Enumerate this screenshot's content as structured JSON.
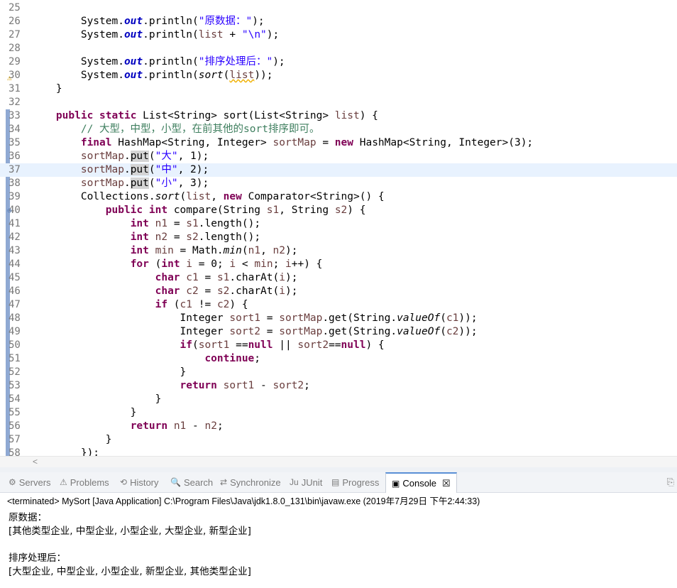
{
  "editor": {
    "lines": [
      {
        "n": "25",
        "html": ""
      },
      {
        "n": "26",
        "html": "        System.<span class='fld'>out</span>.println(<span class='str'>\"原数据：\"</span>);"
      },
      {
        "n": "27",
        "html": "        System.<span class='fld'>out</span>.println(<span class='var'>list</span> + <span class='str'>\"\\n\"</span>);"
      },
      {
        "n": "28",
        "html": ""
      },
      {
        "n": "29",
        "html": "        System.<span class='fld'>out</span>.println(<span class='str'>\"排序处理后：\"</span>);"
      },
      {
        "n": "30",
        "html": "        System.<span class='fld'>out</span>.println(<span class='it'>sort</span>(<span class='var squig'>list</span>));"
      },
      {
        "n": "31",
        "html": "    }"
      },
      {
        "n": "32",
        "html": ""
      },
      {
        "n": "33",
        "html": "    <span class='kw'>public</span> <span class='kw'>static</span> List&lt;String&gt; sort(List&lt;String&gt; <span class='var'>list</span>) {"
      },
      {
        "n": "34",
        "html": "        <span class='cmt'>// 大型，中型，小型，在前其他的sort排序即可。</span>"
      },
      {
        "n": "35",
        "html": "        <span class='kw'>final</span> HashMap&lt;String, Integer&gt; <span class='var'>sortMap</span> = <span class='kw'>new</span> HashMap&lt;String, Integer&gt;(3);"
      },
      {
        "n": "36",
        "html": "        <span class='var'>sortMap</span>.<span class='hl'>put</span>(<span class='str'>\"大\"</span>, 1);"
      },
      {
        "n": "37",
        "html": "        <span class='var'>sortMap</span>.<span class='hl'>put</span>(<span class='str'>\"中\"</span>, 2);"
      },
      {
        "n": "38",
        "html": "        <span class='var'>sortMap</span>.<span class='hl'>put</span>(<span class='str'>\"小\"</span>, 3);"
      },
      {
        "n": "39",
        "html": "        Collections.<span class='it'>sort</span>(<span class='var'>list</span>, <span class='kw'>new</span> Comparator&lt;String&gt;() {"
      },
      {
        "n": "40",
        "html": "            <span class='kw'>public</span> <span class='kw'>int</span> compare(String <span class='var'>s1</span>, String <span class='var'>s2</span>) {"
      },
      {
        "n": "41",
        "html": "                <span class='kw'>int</span> <span class='var'>n1</span> = <span class='var'>s1</span>.length();"
      },
      {
        "n": "42",
        "html": "                <span class='kw'>int</span> <span class='var'>n2</span> = <span class='var'>s2</span>.length();"
      },
      {
        "n": "43",
        "html": "                <span class='kw'>int</span> <span class='var'>min</span> = Math.<span class='it'>min</span>(<span class='var'>n1</span>, <span class='var'>n2</span>);"
      },
      {
        "n": "44",
        "html": "                <span class='kw'>for</span> (<span class='kw'>int</span> <span class='var'>i</span> = 0; <span class='var'>i</span> &lt; <span class='var'>min</span>; <span class='var'>i</span>++) {"
      },
      {
        "n": "45",
        "html": "                    <span class='kw'>char</span> <span class='var'>c1</span> = <span class='var'>s1</span>.charAt(<span class='var'>i</span>);"
      },
      {
        "n": "46",
        "html": "                    <span class='kw'>char</span> <span class='var'>c2</span> = <span class='var'>s2</span>.charAt(<span class='var'>i</span>);"
      },
      {
        "n": "47",
        "html": "                    <span class='kw'>if</span> (<span class='var'>c1</span> != <span class='var'>c2</span>) {"
      },
      {
        "n": "48",
        "html": "                        Integer <span class='var'>sort1</span> = <span class='var'>sortMap</span>.get(String.<span class='it'>valueOf</span>(<span class='var'>c1</span>));"
      },
      {
        "n": "49",
        "html": "                        Integer <span class='var'>sort2</span> = <span class='var'>sortMap</span>.get(String.<span class='it'>valueOf</span>(<span class='var'>c2</span>));"
      },
      {
        "n": "50",
        "html": "                        <span class='kw'>if</span>(<span class='var'>sort1</span> ==<span class='kw'>null</span> || <span class='var'>sort2</span>==<span class='kw'>null</span>) {"
      },
      {
        "n": "51",
        "html": "                            <span class='kw'>continue</span>;"
      },
      {
        "n": "52",
        "html": "                        }"
      },
      {
        "n": "53",
        "html": "                        <span class='kw'>return</span> <span class='var'>sort1</span> - <span class='var'>sort2</span>;"
      },
      {
        "n": "54",
        "html": "                    }"
      },
      {
        "n": "55",
        "html": "                }"
      },
      {
        "n": "56",
        "html": "                <span class='kw'>return</span> <span class='var'>n1</span> - <span class='var'>n2</span>;"
      },
      {
        "n": "57",
        "html": "            }"
      },
      {
        "n": "58",
        "html": "        });"
      }
    ],
    "current_line": "37",
    "warning_line": "30",
    "fold_line": "40"
  },
  "tabs": [
    {
      "id": "servers",
      "label": "Servers",
      "icon": "⚙"
    },
    {
      "id": "problems",
      "label": "Problems",
      "icon": "⚠"
    },
    {
      "id": "history",
      "label": "History",
      "icon": "⟲"
    },
    {
      "id": "search",
      "label": "Search",
      "icon": "🔍"
    },
    {
      "id": "synchronize",
      "label": "Synchronize",
      "icon": "⇄"
    },
    {
      "id": "junit",
      "label": "JUnit",
      "icon": "Ju"
    },
    {
      "id": "progress",
      "label": "Progress",
      "icon": "▤"
    },
    {
      "id": "console",
      "label": "Console",
      "icon": "▣",
      "close": "☒"
    }
  ],
  "console": {
    "status": "<terminated> MySort [Java Application] C:\\Program Files\\Java\\jdk1.8.0_131\\bin\\javaw.exe (2019年7月29日 下午2:44:33)",
    "output": [
      "原数据：",
      "[其他类型企业, 中型企业, 小型企业, 大型企业, 新型企业]",
      "",
      "排序处理后：",
      "[大型企业, 中型企业, 小型企业, 新型企业, 其他类型企业]"
    ]
  },
  "colors": {
    "keyword": "#7f0055",
    "string": "#2a00ff",
    "field": "#0000c0",
    "comment": "#3f7f5f",
    "local_var": "#6a3e3e",
    "current_line_bg": "#e8f2fe"
  }
}
